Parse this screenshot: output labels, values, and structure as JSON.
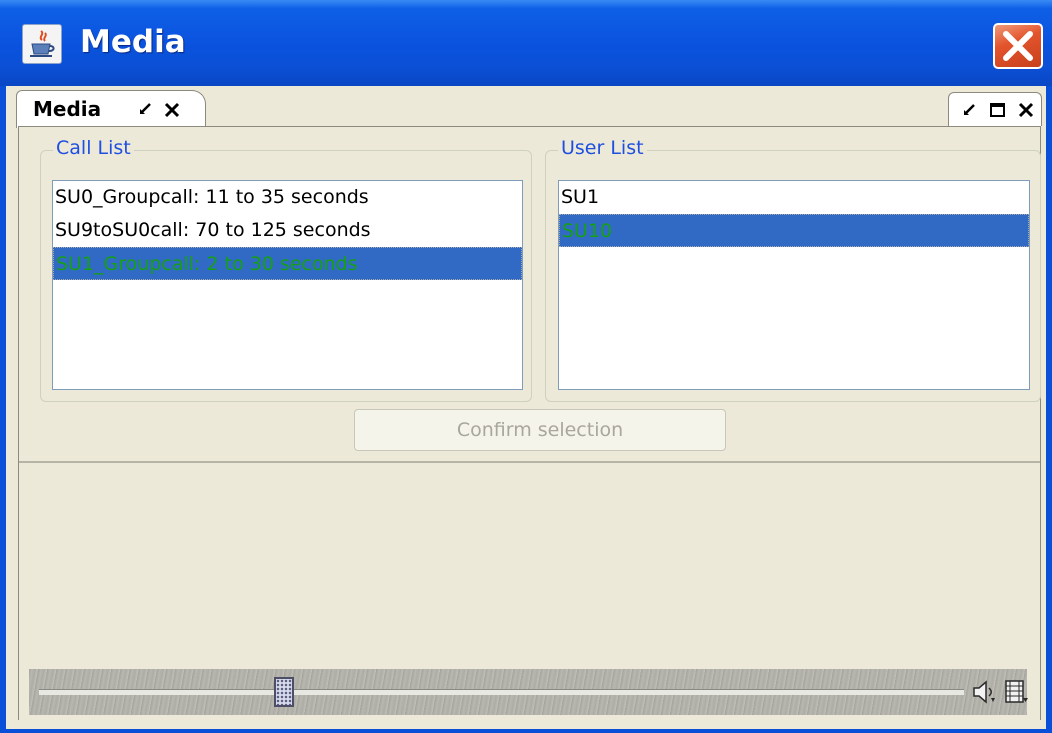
{
  "window": {
    "title": "Media",
    "app_icon": "java-cup-icon",
    "close_icon": "close-icon",
    "colors": {
      "titlebar": "#0a52de",
      "close": "#e2542c",
      "client": "#ece9d8"
    }
  },
  "tabs": [
    {
      "label": "Media",
      "icons": [
        "restore-icon",
        "close-icon"
      ],
      "active": true
    }
  ],
  "view_controls": {
    "icons": [
      "restore-icon",
      "maximize-icon",
      "close-icon"
    ]
  },
  "call_list": {
    "legend": "Call List",
    "items": [
      "SU0_Groupcall: 11 to 35 seconds",
      "SU9toSU0call: 70 to 125 seconds",
      "SU1_Groupcall: 2 to 30 seconds"
    ],
    "selected_index": 2
  },
  "user_list": {
    "legend": "User List",
    "items": [
      "SU1",
      "SU10"
    ],
    "selected_index": 1
  },
  "confirm_button": {
    "label": "Confirm selection",
    "enabled": false
  },
  "player": {
    "seek_position": 0.27,
    "icons": [
      "volume-icon",
      "film-icon"
    ],
    "colors": {
      "selection": "#316ac5",
      "selected_text": "#15a015",
      "legend": "#1f4fe0"
    }
  }
}
